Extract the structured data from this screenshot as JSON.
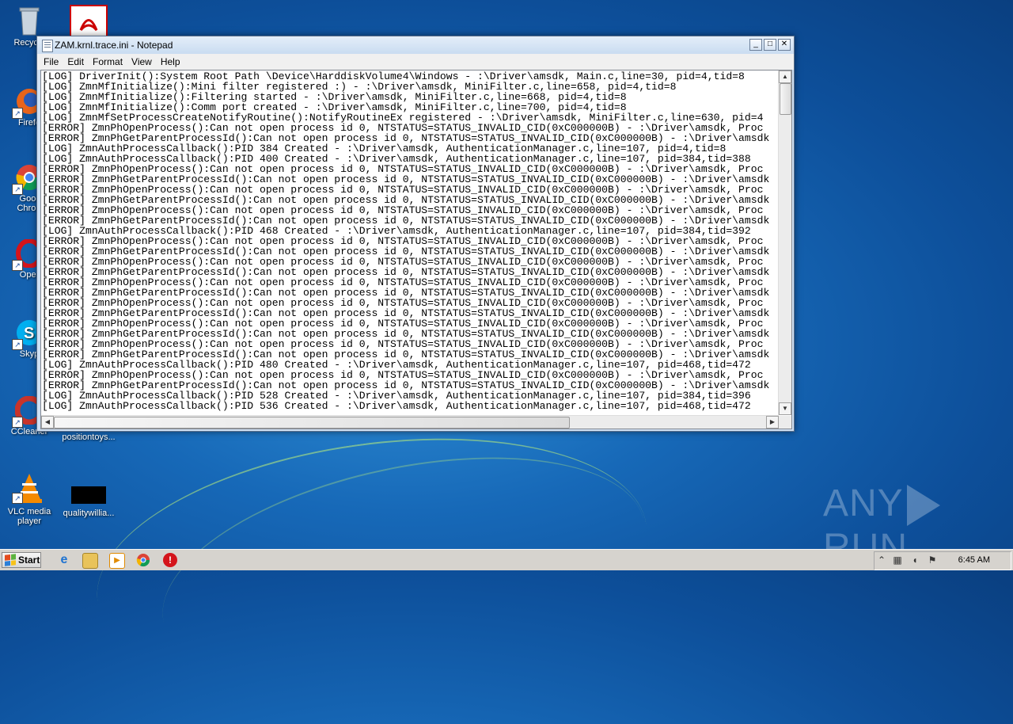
{
  "desktop": {
    "icons": [
      {
        "label": "Recycle",
        "icon": "recycle-bin-icon"
      },
      {
        "label": "Firefo",
        "icon": "firefox-icon"
      },
      {
        "label": "Goog Chrom",
        "icon": "chrome-icon"
      },
      {
        "label": "Oper",
        "icon": "opera-icon"
      },
      {
        "label": "Skyp",
        "icon": "skype-icon"
      },
      {
        "label": "CCleaner",
        "icon": "ccleaner-icon"
      },
      {
        "label": "positiontoys...",
        "icon": "file-icon"
      },
      {
        "label": "VLC media player",
        "icon": "vlc-icon"
      },
      {
        "label": "qualitywillia...",
        "icon": "file-icon"
      }
    ]
  },
  "notepad": {
    "title": "ZAM.krnl.trace.ini - Notepad",
    "menu": [
      "File",
      "Edit",
      "Format",
      "View",
      "Help"
    ],
    "lines": [
      "[LOG] DriverInit():System Root Path \\Device\\HarddiskVolume4\\Windows - :\\Driver\\amsdk, Main.c,line=30, pid=4,tid=8",
      "[LOG] ZmnMfInitialize():Mini filter registered :) - :\\Driver\\amsdk, MiniFilter.c,line=658, pid=4,tid=8",
      "[LOG] ZmnMfInitialize():Filtering started - :\\Driver\\amsdk, MiniFilter.c,line=668, pid=4,tid=8",
      "[LOG] ZmnMfInitialize():Comm port created - :\\Driver\\amsdk, MiniFilter.c,line=700, pid=4,tid=8",
      "[LOG] ZmnMfSetProcessCreateNotifyRoutine():NotifyRoutineEx registered - :\\Driver\\amsdk, MiniFilter.c,line=630, pid=4",
      "[ERROR] ZmnPhOpenProcess():Can not open process id 0, NTSTATUS=STATUS_INVALID_CID(0xC000000B) - :\\Driver\\amsdk, Proc",
      "[ERROR] ZmnPhGetParentProcessId():Can not open process id 0, NTSTATUS=STATUS_INVALID_CID(0xC000000B) - :\\Driver\\amsdk",
      "[LOG] ZmnAuthProcessCallback():PID 384 Created - :\\Driver\\amsdk, AuthenticationManager.c,line=107, pid=4,tid=8",
      "[LOG] ZmnAuthProcessCallback():PID 400 Created - :\\Driver\\amsdk, AuthenticationManager.c,line=107, pid=384,tid=388",
      "[ERROR] ZmnPhOpenProcess():Can not open process id 0, NTSTATUS=STATUS_INVALID_CID(0xC000000B) - :\\Driver\\amsdk, Proc",
      "[ERROR] ZmnPhGetParentProcessId():Can not open process id 0, NTSTATUS=STATUS_INVALID_CID(0xC000000B) - :\\Driver\\amsdk",
      "[ERROR] ZmnPhOpenProcess():Can not open process id 0, NTSTATUS=STATUS_INVALID_CID(0xC000000B) - :\\Driver\\amsdk, Proc",
      "[ERROR] ZmnPhGetParentProcessId():Can not open process id 0, NTSTATUS=STATUS_INVALID_CID(0xC000000B) - :\\Driver\\amsdk",
      "[ERROR] ZmnPhOpenProcess():Can not open process id 0, NTSTATUS=STATUS_INVALID_CID(0xC000000B) - :\\Driver\\amsdk, Proc",
      "[ERROR] ZmnPhGetParentProcessId():Can not open process id 0, NTSTATUS=STATUS_INVALID_CID(0xC000000B) - :\\Driver\\amsdk",
      "[LOG] ZmnAuthProcessCallback():PID 468 Created - :\\Driver\\amsdk, AuthenticationManager.c,line=107, pid=384,tid=392",
      "[ERROR] ZmnPhOpenProcess():Can not open process id 0, NTSTATUS=STATUS_INVALID_CID(0xC000000B) - :\\Driver\\amsdk, Proc",
      "[ERROR] ZmnPhGetParentProcessId():Can not open process id 0, NTSTATUS=STATUS_INVALID_CID(0xC000000B) - :\\Driver\\amsdk",
      "[ERROR] ZmnPhOpenProcess():Can not open process id 0, NTSTATUS=STATUS_INVALID_CID(0xC000000B) - :\\Driver\\amsdk, Proc",
      "[ERROR] ZmnPhGetParentProcessId():Can not open process id 0, NTSTATUS=STATUS_INVALID_CID(0xC000000B) - :\\Driver\\amsdk",
      "[ERROR] ZmnPhOpenProcess():Can not open process id 0, NTSTATUS=STATUS_INVALID_CID(0xC000000B) - :\\Driver\\amsdk, Proc",
      "[ERROR] ZmnPhGetParentProcessId():Can not open process id 0, NTSTATUS=STATUS_INVALID_CID(0xC000000B) - :\\Driver\\amsdk",
      "[ERROR] ZmnPhOpenProcess():Can not open process id 0, NTSTATUS=STATUS_INVALID_CID(0xC000000B) - :\\Driver\\amsdk, Proc",
      "[ERROR] ZmnPhGetParentProcessId():Can not open process id 0, NTSTATUS=STATUS_INVALID_CID(0xC000000B) - :\\Driver\\amsdk",
      "[ERROR] ZmnPhOpenProcess():Can not open process id 0, NTSTATUS=STATUS_INVALID_CID(0xC000000B) - :\\Driver\\amsdk, Proc",
      "[ERROR] ZmnPhGetParentProcessId():Can not open process id 0, NTSTATUS=STATUS_INVALID_CID(0xC000000B) - :\\Driver\\amsdk",
      "[ERROR] ZmnPhOpenProcess():Can not open process id 0, NTSTATUS=STATUS_INVALID_CID(0xC000000B) - :\\Driver\\amsdk, Proc",
      "[ERROR] ZmnPhGetParentProcessId():Can not open process id 0, NTSTATUS=STATUS_INVALID_CID(0xC000000B) - :\\Driver\\amsdk",
      "[LOG] ZmnAuthProcessCallback():PID 480 Created - :\\Driver\\amsdk, AuthenticationManager.c,line=107, pid=468,tid=472",
      "[ERROR] ZmnPhOpenProcess():Can not open process id 0, NTSTATUS=STATUS_INVALID_CID(0xC000000B) - :\\Driver\\amsdk, Proc",
      "[ERROR] ZmnPhGetParentProcessId():Can not open process id 0, NTSTATUS=STATUS_INVALID_CID(0xC000000B) - :\\Driver\\amsdk",
      "[LOG] ZmnAuthProcessCallback():PID 528 Created - :\\Driver\\amsdk, AuthenticationManager.c,line=107, pid=384,tid=396",
      "[LOG] ZmnAuthProcessCallback():PID 536 Created - :\\Driver\\amsdk, AuthenticationManager.c,line=107, pid=468,tid=472"
    ]
  },
  "taskbar": {
    "start_label": "Start",
    "pinned": [
      "internet-explorer-icon",
      "file-explorer-icon",
      "media-player-icon",
      "chrome-icon",
      "security-icon"
    ],
    "clock": "6:45 AM"
  },
  "watermark": {
    "left": "ANY",
    "right": "RUN"
  }
}
